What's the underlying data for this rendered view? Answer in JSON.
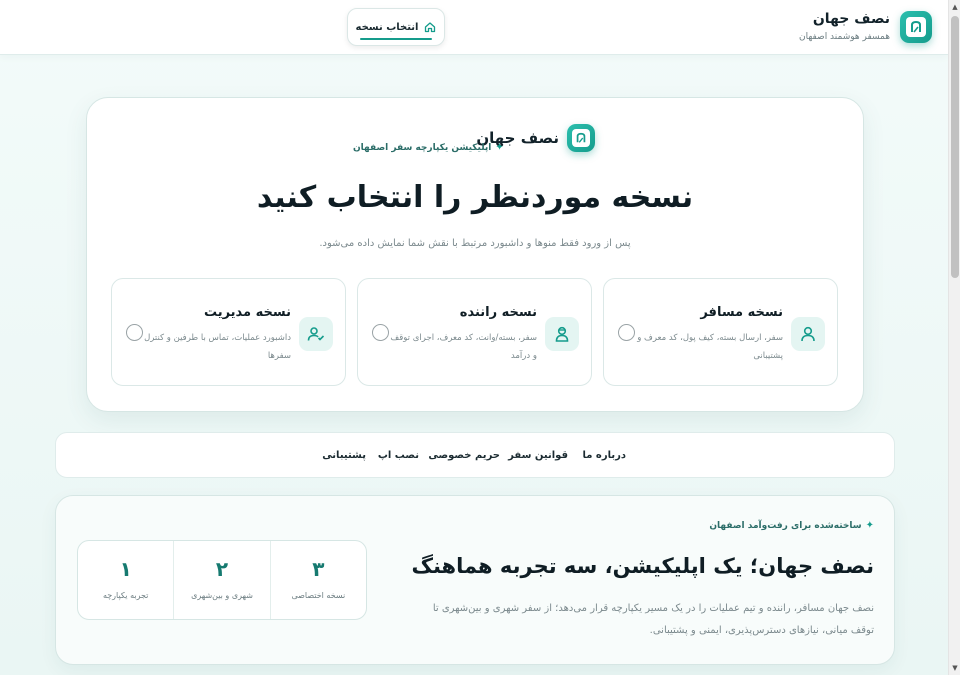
{
  "header": {
    "brand_name": "نصف جهان",
    "brand_subtitle": "همسفر هوشمند اصفهان",
    "version_button": "انتخاب نسخه"
  },
  "hero": {
    "brand_name": "نصف جهان",
    "tagline": "اپلیکیشن یکپارچه سفر اصفهان",
    "title": "نسخه موردنظر را انتخاب کنید",
    "description": "پس از ورود فقط منوها و داشبورد مرتبط با نقش شما نمایش داده می‌شود.",
    "choices": [
      {
        "title": "نسخه مسافر",
        "description": "سفر، ارسال بسته، کیف پول، کد معرف و پشتیبانی",
        "icon": "user-icon"
      },
      {
        "title": "نسخه راننده",
        "description": "سفر، بسته/وانت، کد معرف، اجرای توقف و درآمد",
        "icon": "driver-icon"
      },
      {
        "title": "نسخه مدیریت",
        "description": "داشبورد عملیات، تماس با طرفین و کنترل سفرها",
        "icon": "admin-user-check-icon"
      }
    ]
  },
  "links": [
    "درباره ما",
    "قوانین سفر",
    "حریم خصوصی",
    "نصب اپ",
    "پشتیبانی"
  ],
  "about": {
    "kicker": "ساخته‌شده برای رفت‌وآمد اصفهان",
    "title": "نصف جهان؛ یک اپلیکیشن، سه تجربه هماهنگ",
    "description": "نصف جهان مسافر، راننده و تیم عملیات را در یک مسیر یکپارچه قرار می‌دهد؛ از سفر شهری و بین‌شهری تا توقف میانی، نیازهای دسترس‌پذیری، ایمنی و پشتیبانی.",
    "stats": [
      {
        "value": "۳",
        "label": "نسخه اختصاصی"
      },
      {
        "value": "۲",
        "label": "شهری و بین‌شهری"
      },
      {
        "value": "۱",
        "label": "تجربه یکپارچه"
      }
    ]
  },
  "colors": {
    "accent": "#159c8c",
    "accent_light": "#e4f5f2",
    "text": "#0f1d24",
    "muted": "#7b898d"
  }
}
